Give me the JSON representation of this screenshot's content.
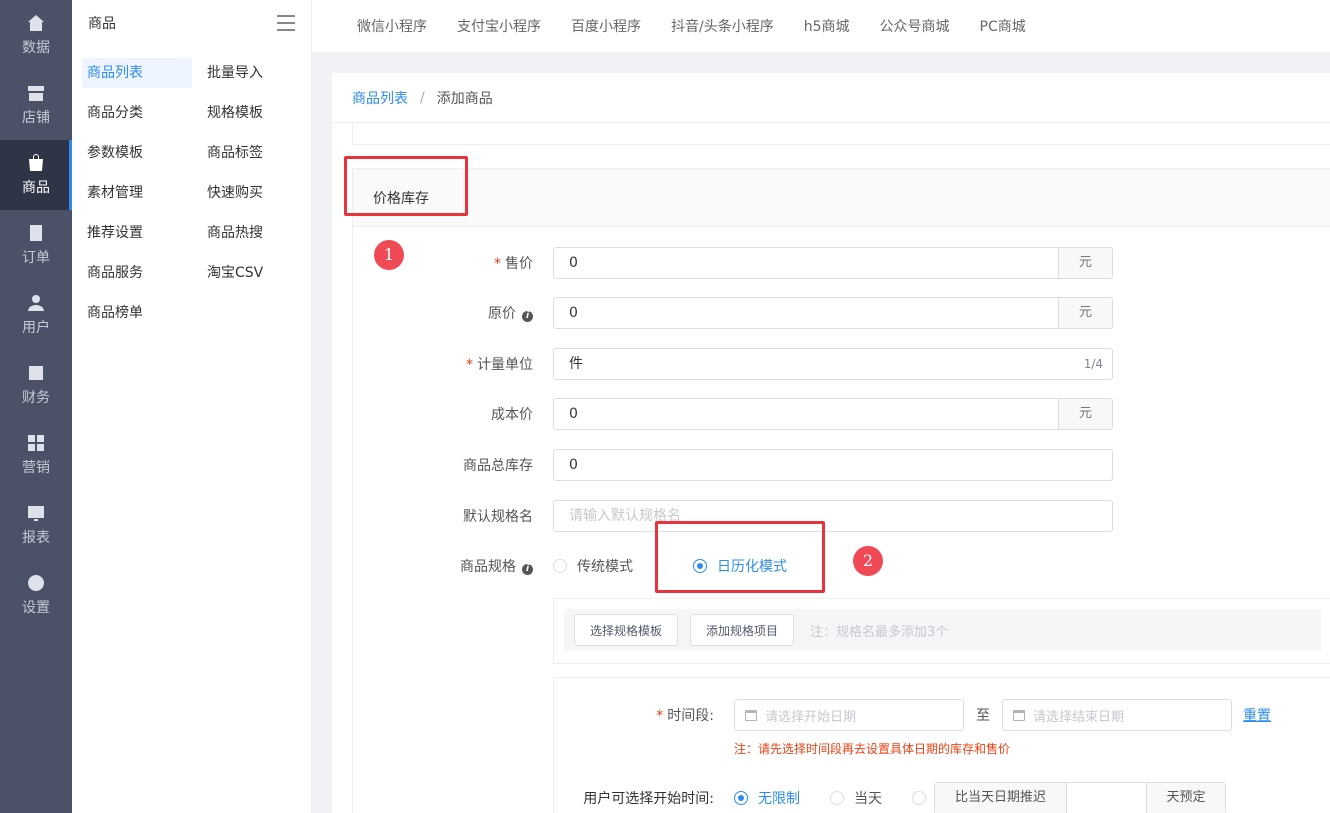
{
  "rail": [
    {
      "icon": "home-icon",
      "label": "数据"
    },
    {
      "icon": "store-icon",
      "label": "店铺"
    },
    {
      "icon": "bag-icon",
      "label": "商品"
    },
    {
      "icon": "order-icon",
      "label": "订单"
    },
    {
      "icon": "user-icon",
      "label": "用户"
    },
    {
      "icon": "finance-icon",
      "label": "财务"
    },
    {
      "icon": "marketing-icon",
      "label": "营销"
    },
    {
      "icon": "report-icon",
      "label": "报表"
    },
    {
      "icon": "gear-icon",
      "label": "设置"
    }
  ],
  "submenu": {
    "title": "商品",
    "items": [
      "商品列表",
      "批量导入",
      "商品分类",
      "规格模板",
      "参数模板",
      "商品标签",
      "素材管理",
      "快速购买",
      "推荐设置",
      "商品热搜",
      "商品服务",
      "淘宝CSV",
      "商品榜单"
    ]
  },
  "top_tabs": [
    "微信小程序",
    "支付宝小程序",
    "百度小程序",
    "抖音/头条小程序",
    "h5商城",
    "公众号商城",
    "PC商城"
  ],
  "breadcrumb": {
    "link": "商品列表",
    "sep": "/",
    "current": "添加商品"
  },
  "section": {
    "title": "价格库存"
  },
  "form": {
    "price": {
      "label": "售价",
      "value": "0",
      "suffix": "元"
    },
    "orig_price": {
      "label": "原价",
      "value": "0",
      "suffix": "元"
    },
    "unit": {
      "label": "计量单位",
      "value": "件",
      "count": "1/4"
    },
    "cost": {
      "label": "成本价",
      "value": "0",
      "suffix": "元"
    },
    "stock": {
      "label": "商品总库存",
      "value": "0"
    },
    "spec_name": {
      "label": "默认规格名",
      "placeholder": "请输入默认规格名"
    },
    "spec": {
      "label": "商品规格",
      "option1": "传统模式",
      "option2": "日历化模式"
    },
    "spec_buttons": {
      "choose": "选择规格模板",
      "add": "添加规格项目",
      "tip": "注：规格名最多添加3个"
    },
    "calendar": {
      "period_label": "时间段:",
      "start_placeholder": "请选择开始日期",
      "to": "至",
      "end_placeholder": "请选择结束日期",
      "reset": "重置",
      "warning": "注：请先选择时间段再去设置具体日期的库存和售价",
      "start_label": "用户可选择开始时间:",
      "opt_unlimited": "无限制",
      "opt_today": "当天",
      "delay_prefix": "比当天日期推迟",
      "delay_suffix": "天预定"
    }
  },
  "annotations": {
    "badge1": "1",
    "badge2": "2"
  },
  "colors": {
    "accent": "#2d8cf0",
    "rail": "#4b5267",
    "annotation": "#e8323c"
  }
}
